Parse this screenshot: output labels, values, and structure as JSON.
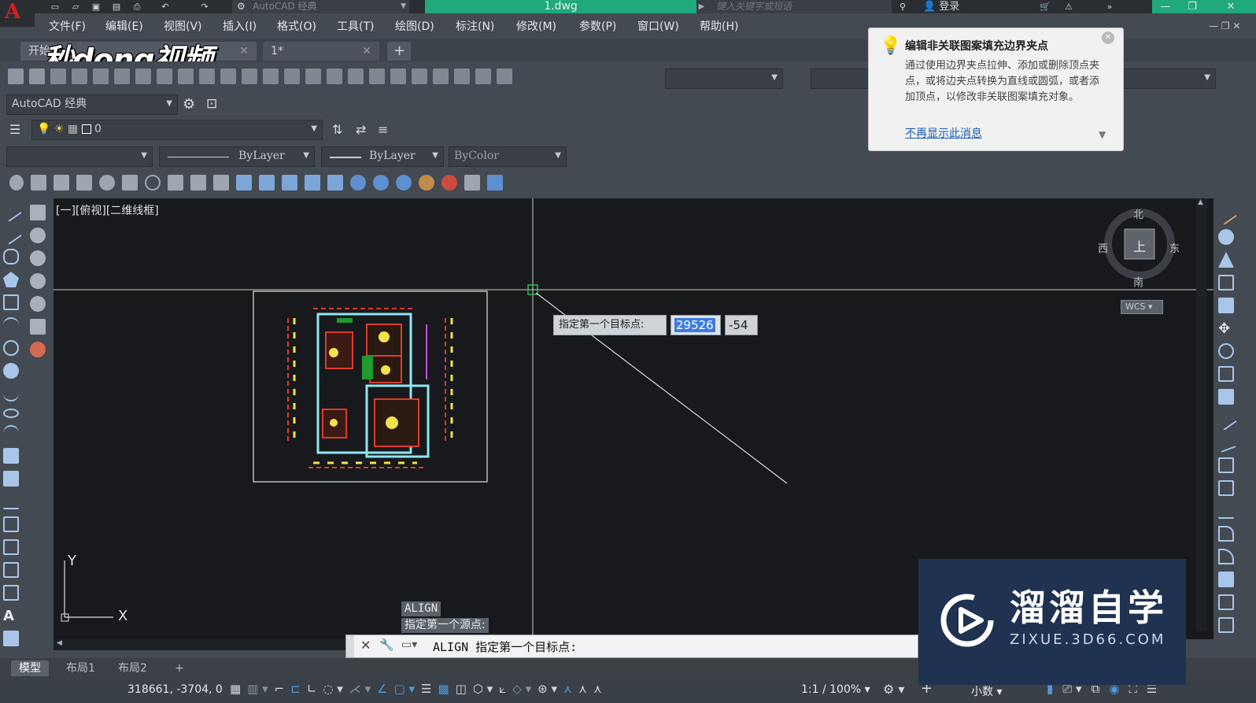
{
  "app": {
    "logo_letter": "A",
    "workspace_title": "AutoCAD 经典",
    "document_title": "1.dwg",
    "search_placeholder": "键入关键字或短语",
    "login_label": "登录"
  },
  "menu": [
    "文件(F)",
    "编辑(E)",
    "视图(V)",
    "插入(I)",
    "格式(O)",
    "工具(T)",
    "绘图(D)",
    "标注(N)",
    "修改(M)",
    "参数(P)",
    "窗口(W)",
    "帮助(H)"
  ],
  "file_tabs": {
    "start": "开始",
    "drawing": "1*",
    "add": "+"
  },
  "overlay_logo": "秒dong视频",
  "toolbars": {
    "workspace_combo": "AutoCAD 经典",
    "layer_combo": "0",
    "linetype_combo": "ByLayer",
    "lineweight_combo": "ByLayer",
    "color_combo": "ByColor"
  },
  "viewport": {
    "label": "[一][俯视][二维线框]",
    "ucs_x": "X",
    "ucs_y": "Y"
  },
  "viewcube": {
    "north": "北",
    "south": "南",
    "east": "东",
    "west": "西",
    "top": "上",
    "wcs": "WCS"
  },
  "notification": {
    "title": "编辑非关联图案填充边界夹点",
    "body": "通过使用边界夹点拉伸、添加或删除顶点夹点，或将边夹点转换为直线或圆弧，或者添加顶点，以修改非关联图案填充对象。",
    "link": "不再显示此消息"
  },
  "dynamic_input": {
    "prompt": "指定第一个目标点:",
    "x_value": "29526",
    "y_value": "-54"
  },
  "command_line": {
    "history": [
      "ALIGN",
      "指定第一个源点:"
    ],
    "current": "ALIGN 指定第一个目标点:"
  },
  "layout_tabs": [
    "模型",
    "布局1",
    "布局2",
    "+"
  ],
  "status": {
    "coordinates": "318661, -3704, 0",
    "annotation_scale": "1:1 / 100%",
    "units": "小数"
  },
  "brand": {
    "title": "溜溜自学",
    "url": "ZIXUE.3D66.COM"
  },
  "colors": {
    "accent": "#1fa97d",
    "canvas": "#17191c",
    "ui": "#444a52",
    "brand_bg": "#1f3251"
  }
}
